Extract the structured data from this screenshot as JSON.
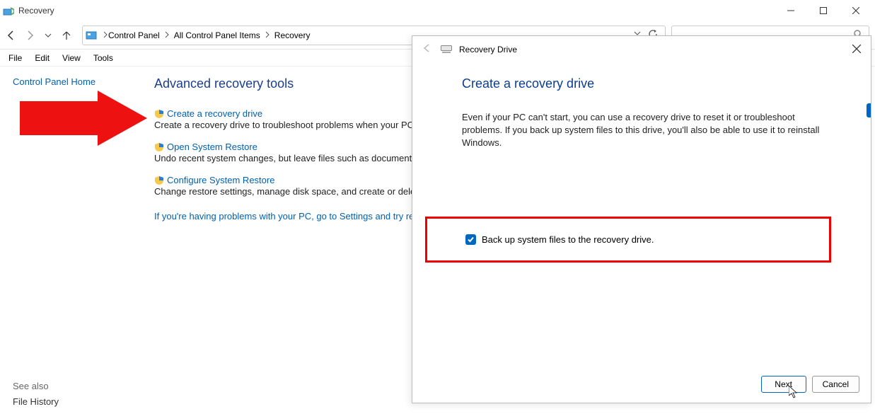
{
  "titlebar": {
    "title": "Recovery"
  },
  "breadcrumb": {
    "items": [
      "Control Panel",
      "All Control Panel Items",
      "Recovery"
    ]
  },
  "menubar": {
    "items": [
      "File",
      "Edit",
      "View",
      "Tools"
    ]
  },
  "sidebar": {
    "home_link": "Control Panel Home",
    "see_also": "See also",
    "file_history": "File History"
  },
  "main": {
    "heading": "Advanced recovery tools",
    "tools": [
      {
        "link": "Create a recovery drive",
        "desc": "Create a recovery drive to troubleshoot problems when your PC can'"
      },
      {
        "link": "Open System Restore",
        "desc": "Undo recent system changes, but leave files such as documents, pict"
      },
      {
        "link": "Configure System Restore",
        "desc": "Change restore settings, manage disk space, and create or delete res"
      }
    ],
    "reset_link": "If you're having problems with your PC, go to Settings and try resett"
  },
  "dialog": {
    "header_title": "Recovery Drive",
    "heading": "Create a recovery drive",
    "body": "Even if your PC can't start, you can use a recovery drive to reset it or troubleshoot problems. If you back up system files to this drive, you'll also be able to use it to reinstall Windows.",
    "checkbox_label": "Back up system files to the recovery drive.",
    "next": "Next",
    "cancel": "Cancel"
  }
}
